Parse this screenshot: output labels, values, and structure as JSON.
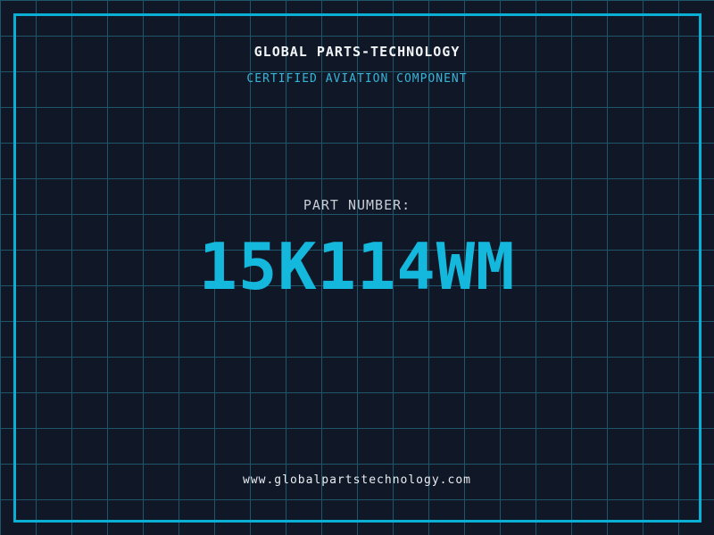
{
  "page": {
    "title": "GLOBAL PARTS-TECHNOLOGY",
    "subtitle": "CERTIFIED AVIATION COMPONENT",
    "part_label": "PART NUMBER:",
    "part_number": "15K114WM",
    "website": "www.globalpartstechnology.com"
  },
  "colors": {
    "background": "#101828",
    "grid_line": "#1e5569",
    "frame_border": "#0ab0d4",
    "accent_cyan": "#14b8dc",
    "subtitle_cyan": "#37b4d7",
    "title_text": "#f2f5f8",
    "label_text": "#c8cdd5",
    "url_text": "#e9edf1"
  }
}
